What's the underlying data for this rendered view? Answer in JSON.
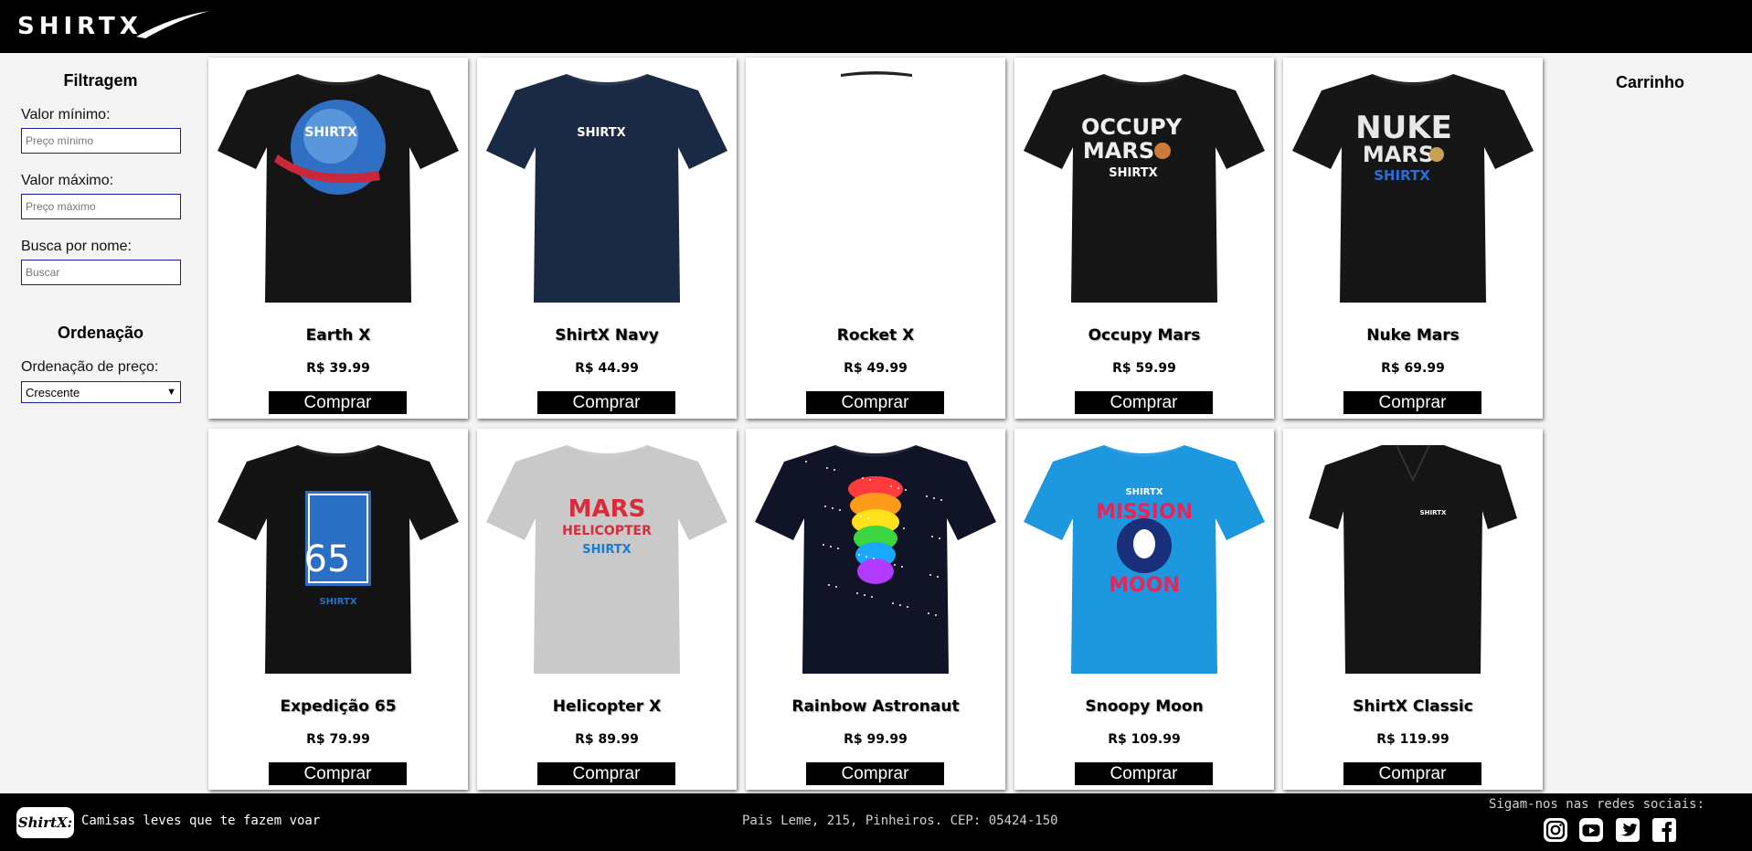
{
  "header": {
    "logo_text": "SHIRTX"
  },
  "filters": {
    "heading": "Filtragem",
    "min_label": "Valor mínimo:",
    "min_placeholder": "Preço mínimo",
    "max_label": "Valor máximo:",
    "max_placeholder": "Preço máximo",
    "search_label": "Busca por nome:",
    "search_placeholder": "Buscar"
  },
  "sorting": {
    "heading": "Ordenação",
    "price_label": "Ordenação de preço:",
    "selected": "Crescente"
  },
  "cart": {
    "title": "Carrinho"
  },
  "buy_label": "Comprar",
  "products": [
    {
      "name": "Earth X",
      "price": "R$ 39.99",
      "shirt_color": "#151515",
      "print": "earth"
    },
    {
      "name": "ShirtX Navy",
      "price": "R$ 44.99",
      "shirt_color": "#1a2a44",
      "print": "logo"
    },
    {
      "name": "Rocket X",
      "price": "R$ 49.99",
      "shirt_color": "#222222",
      "print": "none"
    },
    {
      "name": "Occupy Mars",
      "price": "R$ 59.99",
      "shirt_color": "#161616",
      "print": "occupy"
    },
    {
      "name": "Nuke Mars",
      "price": "R$ 69.99",
      "shirt_color": "#161616",
      "print": "nuke"
    },
    {
      "name": "Expedição 65",
      "price": "R$ 79.99",
      "shirt_color": "#141414",
      "print": "exp65"
    },
    {
      "name": "Helicopter X",
      "price": "R$ 89.99",
      "shirt_color": "#c9c9c9",
      "print": "heli"
    },
    {
      "name": "Rainbow Astronaut",
      "price": "R$ 99.99",
      "shirt_color": "#101426",
      "print": "rainbow"
    },
    {
      "name": "Snoopy Moon",
      "price": "R$ 109.99",
      "shirt_color": "#1d97de",
      "print": "snoopy"
    },
    {
      "name": "ShirtX Classic",
      "price": "R$ 119.99",
      "shirt_color": "#151515",
      "print": "polo"
    }
  ],
  "footer": {
    "logo_text": "ShirtX:",
    "tagline": "Camisas leves que te fazem voar",
    "address": "Pais Leme, 215, Pinheiros. CEP: 05424-150",
    "social_label": "Sigam-nos nas redes sociais:",
    "social_icons": [
      "instagram-icon",
      "youtube-icon",
      "twitter-icon",
      "facebook-icon"
    ]
  }
}
